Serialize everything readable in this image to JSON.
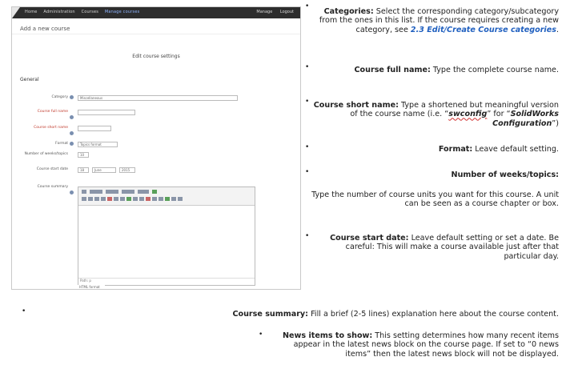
{
  "screenshot": {
    "nav_items": [
      "Home",
      "Administration",
      "Courses",
      "Manage courses"
    ],
    "nav_right": [
      "Manage",
      "Logout"
    ],
    "page_title": "Add a new course",
    "form_heading": "Edit course settings",
    "section_general": "General",
    "labels": {
      "category": "Category",
      "fullname": "Course full name",
      "shortname": "Course short name",
      "format": "Format",
      "numsections": "Number of weeks/topics",
      "startdate": "Course start date",
      "summary": "Course summary"
    },
    "values": {
      "category": "Miscellaneous",
      "format": "Topics format",
      "numsections": "10",
      "start_day": "18",
      "start_month": "June",
      "start_year": "2015",
      "editor_path": "Path: p",
      "editor_format": "HTML format"
    }
  },
  "notes": {
    "categories": {
      "term": "Categories:",
      "text1": " Select the corresponding category/subcategory from the ones in this list.  If the course requires creating a new category, see ",
      "link": "2.3 Edit/Create Course categories",
      "text2": "."
    },
    "fullname": {
      "term": "Course full name:",
      "text": " Type the complete course name."
    },
    "shortname": {
      "term": "Course short name:",
      "text1": " Type a shortened but meaningful version of the course name (i.e. “",
      "code": "swconfig",
      "text2": "” for “",
      "example": "SolidWorks Configuration",
      "text3": "”)"
    },
    "format": {
      "term": "Format:",
      "text": " Leave default setting."
    },
    "numweeks": {
      "term": "Number of weeks/topics:",
      "text": "Type the number of course units you want for this course. A unit can be seen as a course chapter or box."
    },
    "startdate": {
      "term": "Course start date:",
      "text": " Leave default setting or set a date.  Be careful: This will make a course available just after that particular day."
    },
    "summary": {
      "term": "Course summary:",
      "text": " Fill a brief (2-5 lines) explanation here about the course content."
    },
    "news": {
      "term": "News items to show:",
      "text": " This setting determines how many recent items appear in the latest news block on the course page. If set to “0 news items” then the latest news block will not be displayed."
    }
  }
}
